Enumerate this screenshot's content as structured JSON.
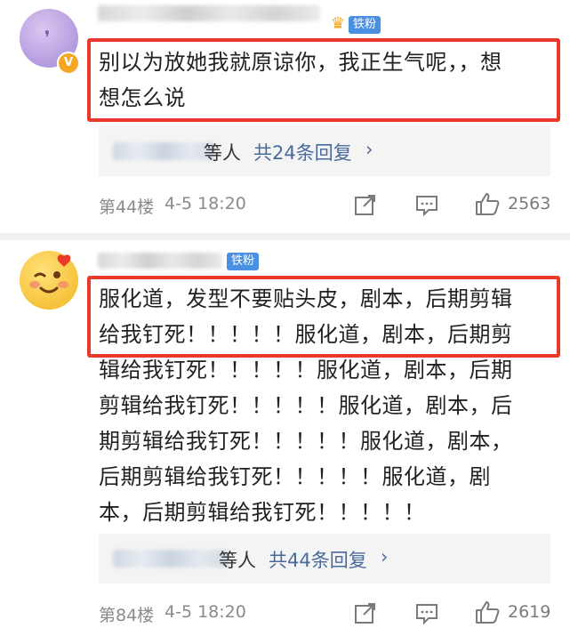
{
  "comments": [
    {
      "badge": "铁粉",
      "text_lines": [
        "别以为放她我就原谅你，我正生气呢，，想",
        "想怎么说"
      ],
      "reply_suffix": "等人",
      "reply_link": "共24条回复",
      "reply_chevron": "›",
      "floor": "第44楼",
      "time": "4-5 18:20",
      "likes": "2563",
      "badge_icon": "crown-icon",
      "avatar_badge_icon": "v-verified-icon"
    },
    {
      "badge": "铁粉",
      "text_lines": [
        "服化道，发型不要贴头皮，剧本，后期剪辑",
        "给我钉死！！！！！服化道，剧本，后期剪",
        "辑给我钉死！！！！！服化道，剧本，后期",
        "剪辑给我钉死！！！！！服化道，剧本，后",
        "期剪辑给我钉死！！！！！服化道，剧本，",
        "后期剪辑给我钉死！！！！！服化道，剧",
        "本，后期剪辑给我钉死！！！！！"
      ],
      "reply_suffix": "等人",
      "reply_link": "共44条回复",
      "reply_chevron": "›",
      "floor": "第84楼",
      "time": "4-5 18:20",
      "likes": "2619",
      "avatar_icon": "winking-face-emoji-icon"
    }
  ],
  "icons": {
    "share": "share-icon",
    "comment": "comment-icon",
    "like": "thumbs-up-icon"
  },
  "colors": {
    "highlight_border": "#e8392c",
    "link": "#4a6a9c",
    "fan_badge": "#4a90e2",
    "verified": "#f5a623"
  }
}
